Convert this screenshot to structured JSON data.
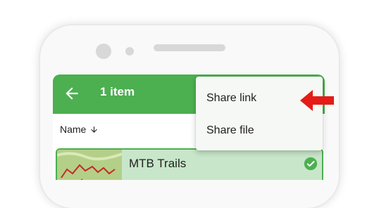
{
  "appbar": {
    "title": "1 item",
    "back_icon": "arrow-left-icon",
    "color": "#4caf50"
  },
  "sort": {
    "label": "Name",
    "direction_icon": "arrow-down-icon"
  },
  "list": {
    "items": [
      {
        "name": "MTB Trails",
        "selected": true,
        "selected_icon": "check-circle-icon",
        "selected_color": "#c8e6c9"
      }
    ]
  },
  "menu": {
    "items": [
      {
        "label": "Share link"
      },
      {
        "label": "Share file"
      }
    ]
  },
  "annotation": {
    "icon": "red-arrow-icon",
    "color": "#e41b17"
  }
}
